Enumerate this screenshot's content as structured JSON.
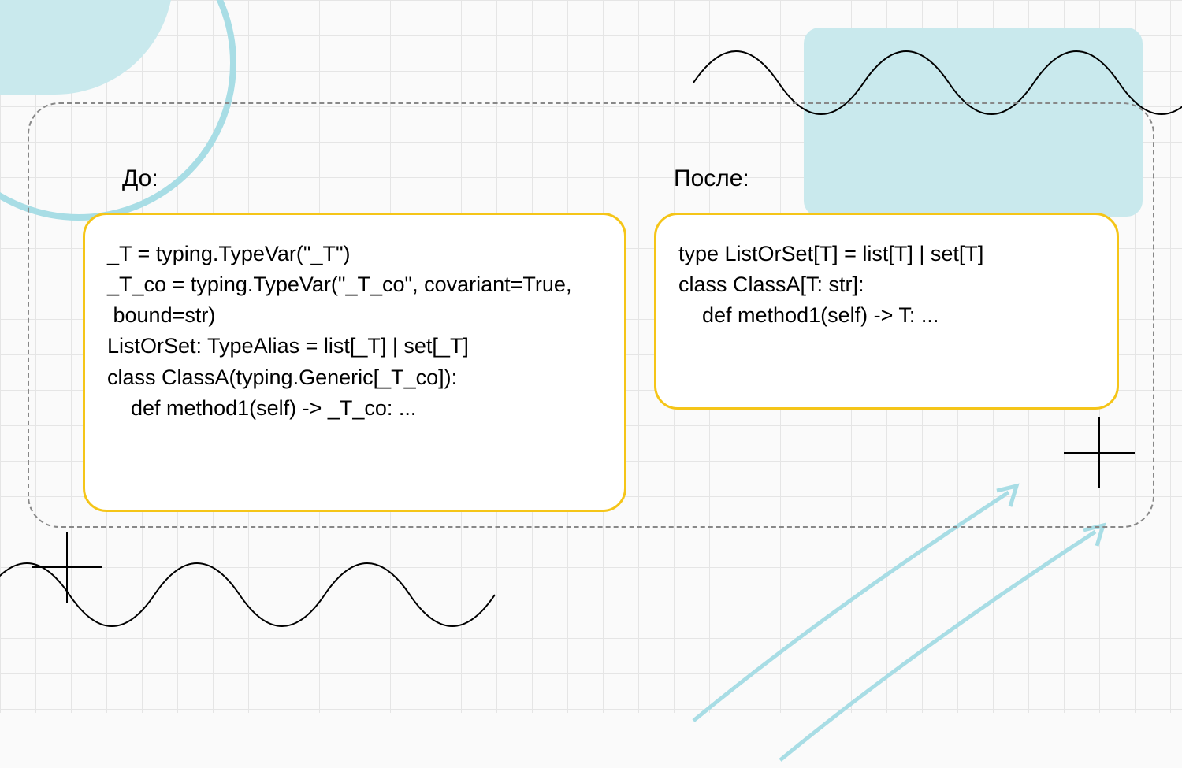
{
  "labels": {
    "before": "До:",
    "after": "После:"
  },
  "code_before": {
    "line1": "_T = typing.TypeVar(\"_T\")",
    "line2": "_T_co = typing.TypeVar(\"_T_co\", covariant=True,",
    "line3": " bound=str)",
    "line4": "",
    "line5": "ListOrSet: TypeAlias = list[_T] | set[_T]",
    "line6": "",
    "line7": "class ClassA(typing.Generic[_T_co]):",
    "line8": "    def method1(self) -> _T_co: ..."
  },
  "code_after": {
    "line1": "type ListOrSet[T] = list[T] | set[T]",
    "line2": "",
    "line3": "class ClassA[T: str]:",
    "line4": "    def method1(self) -> T: ..."
  }
}
